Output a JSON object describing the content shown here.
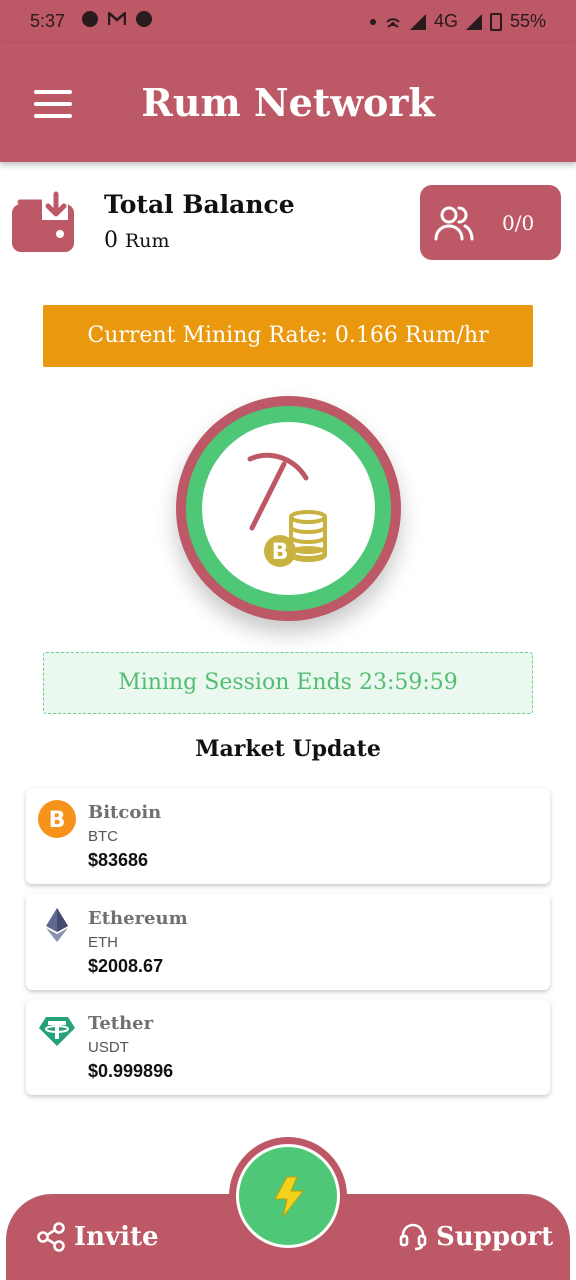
{
  "status_bar": {
    "time": "5:37",
    "network": "4G",
    "battery": "55%"
  },
  "header": {
    "title": "Rum Network",
    "menu_icon": "hamburger-menu-icon"
  },
  "balance": {
    "title": "Total Balance",
    "amount": "0",
    "unit": "Rum",
    "icon": "wallet-download-icon"
  },
  "team": {
    "count": "0/0",
    "icon": "users-icon"
  },
  "mining": {
    "rate_text": "Current Mining Rate: 0.166 Rum/hr",
    "session_text": "Mining Session Ends 23:59:59",
    "icon": "pickaxe-coins-icon"
  },
  "market": {
    "title": "Market Update",
    "coins": [
      {
        "name": "Bitcoin",
        "symbol": "BTC",
        "price": "$83686",
        "icon": "bitcoin-icon"
      },
      {
        "name": "Ethereum",
        "symbol": "ETH",
        "price": "$2008.67",
        "icon": "ethereum-icon"
      },
      {
        "name": "Tether",
        "symbol": "USDT",
        "price": "$0.999896",
        "icon": "tether-icon"
      }
    ]
  },
  "bottom_nav": {
    "invite_label": "Invite",
    "support_label": "Support",
    "invite_icon": "share-icon",
    "support_icon": "headset-icon",
    "center_icon": "lightning-icon"
  },
  "colors": {
    "primary": "#bd5866",
    "accent_orange": "#ea980e",
    "success_green": "#4ec776",
    "coin_gold": "#c9b240"
  }
}
